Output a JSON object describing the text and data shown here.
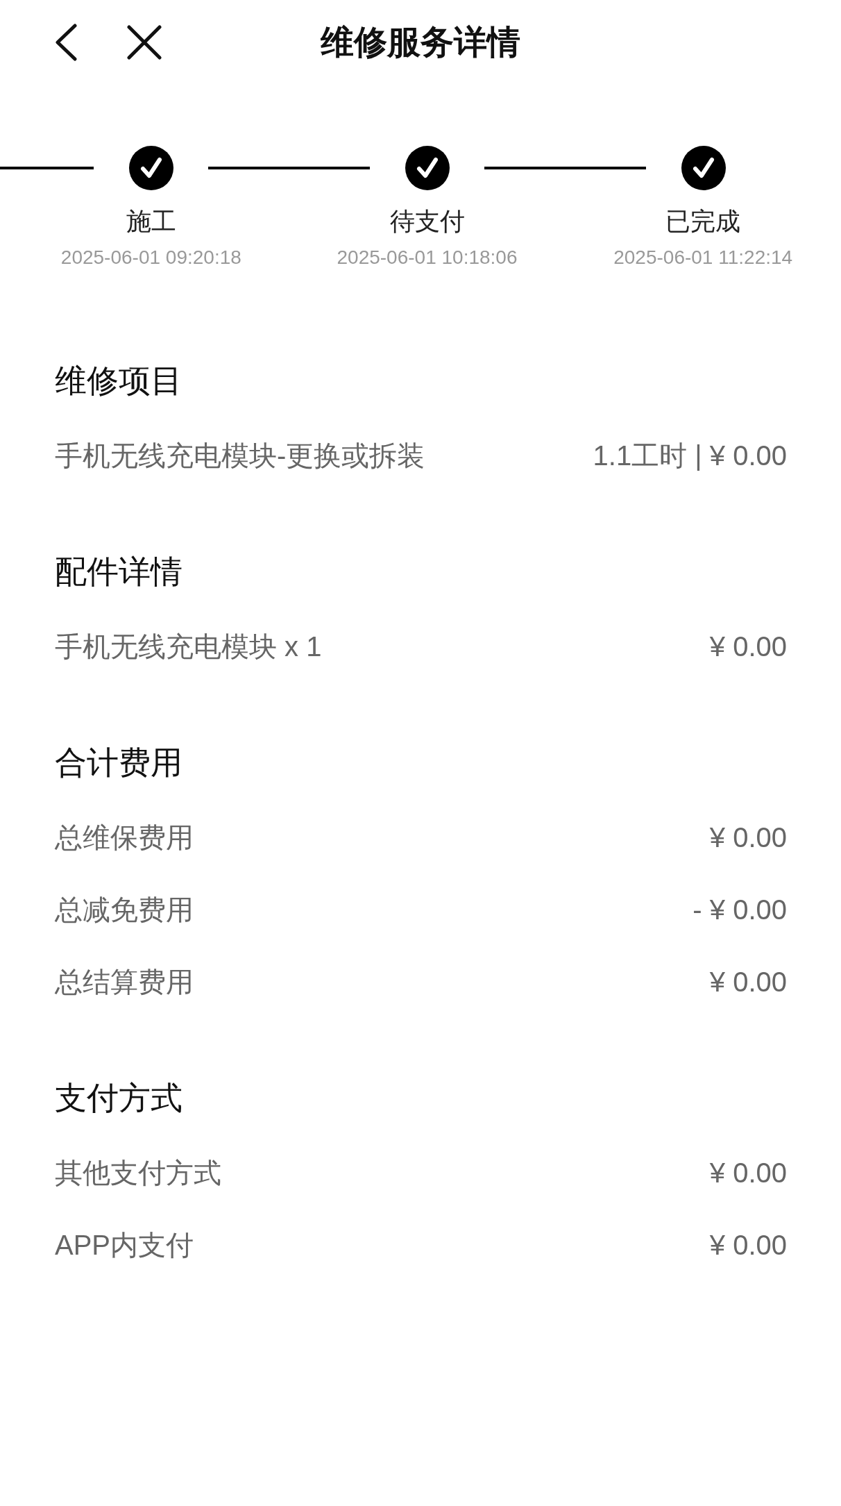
{
  "header": {
    "title": "维修服务详情"
  },
  "steps": [
    {
      "label": "施工",
      "time": "2025-06-01 09:20:18",
      "completed": true
    },
    {
      "label": "待支付",
      "time": "2025-06-01 10:18:06",
      "completed": true
    },
    {
      "label": "已完成",
      "time": "2025-06-01 11:22:14",
      "completed": true
    }
  ],
  "sections": [
    {
      "title": "维修项目",
      "rows": [
        {
          "label": "手机无线充电模块-更换或拆装",
          "value": "1.1工时 | ¥ 0.00"
        }
      ]
    },
    {
      "title": "配件详情",
      "rows": [
        {
          "label": "手机无线充电模块 x 1",
          "value": "¥ 0.00"
        }
      ]
    },
    {
      "title": "合计费用",
      "rows": [
        {
          "label": "总维保费用",
          "value": "¥ 0.00"
        },
        {
          "label": "总减免费用",
          "value": "- ¥ 0.00"
        },
        {
          "label": "总结算费用",
          "value": "¥ 0.00"
        }
      ]
    },
    {
      "title": "支付方式",
      "rows": [
        {
          "label": "其他支付方式",
          "value": "¥ 0.00"
        },
        {
          "label": "APP内支付",
          "value": "¥ 0.00"
        }
      ]
    }
  ]
}
